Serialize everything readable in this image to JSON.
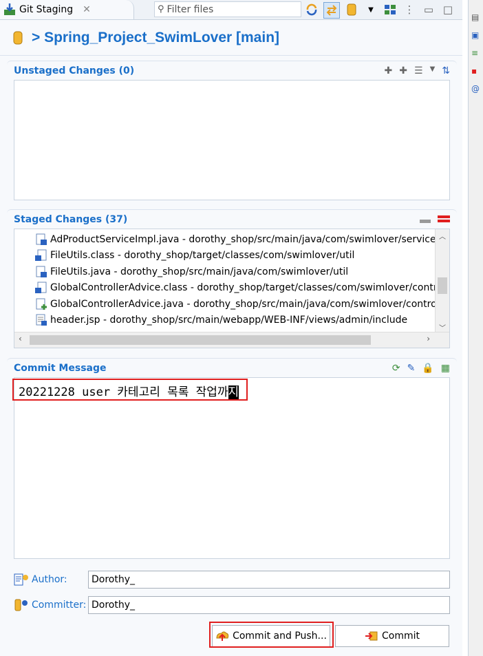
{
  "tab": {
    "label": "Git Staging",
    "close": "✕"
  },
  "filter": {
    "placeholder": "Filter files"
  },
  "header": {
    "repo": "> Spring_Project_SwimLover [main]"
  },
  "unstaged": {
    "title": "Unstaged Changes (0)"
  },
  "staged": {
    "title": "Staged Changes (37)",
    "files": [
      "AdProductServiceImpl.java - dorothy_shop/src/main/java/com/swimlover/service",
      "FileUtils.class - dorothy_shop/target/classes/com/swimlover/util",
      "FileUtils.java - dorothy_shop/src/main/java/com/swimlover/util",
      "GlobalControllerAdvice.class - dorothy_shop/target/classes/com/swimlover/control",
      "GlobalControllerAdvice.java - dorothy_shop/src/main/java/com/swimlover/controlle",
      "header.jsp - dorothy_shop/src/main/webapp/WEB-INF/views/admin/include"
    ]
  },
  "commit": {
    "title": "Commit Message",
    "message": "20221228 user 카테고리 목록 작업까",
    "cursor_char": "지",
    "author_label": "Author:",
    "author_value": "Dorothy_",
    "committer_label": "Committer:",
    "committer_value": "Dorothy_",
    "commit_push_label": "Commit and Push...",
    "commit_label": "Commit"
  },
  "colors": {
    "accent": "#1a6fc9",
    "highlight": "#e01e1e"
  }
}
